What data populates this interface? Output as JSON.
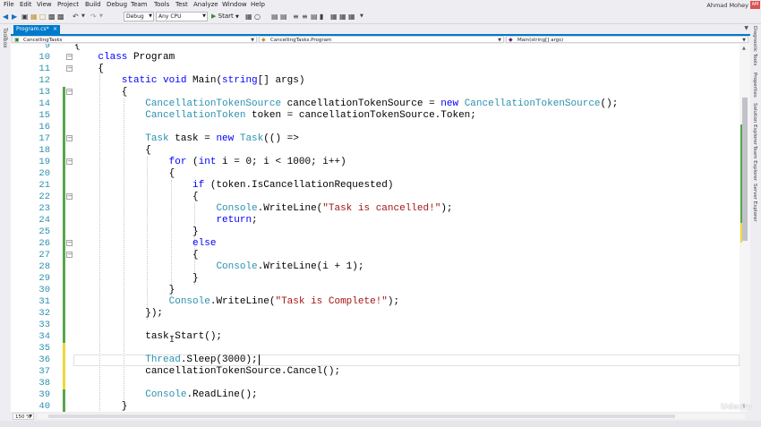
{
  "menu": [
    "File",
    "Edit",
    "View",
    "Project",
    "Build",
    "Debug",
    "Team",
    "Tools",
    "Test",
    "Analyze",
    "Window",
    "Help"
  ],
  "user": {
    "name": "Ahmad Mohey",
    "initials": "AM"
  },
  "toolbar": {
    "config": "Debug",
    "platform": "Any CPU",
    "start": "Start"
  },
  "tabs": {
    "active": "Program.cs*"
  },
  "side": {
    "left": "Toolbox",
    "right": [
      "Diagnostic Tools",
      "Properties",
      "Solution Explorer",
      "Team Explorer",
      "Server Explorer"
    ]
  },
  "nav": {
    "project": "CancellingTasks",
    "type": "CancellingTasks.Program",
    "member": "Main(string[] args)"
  },
  "editor": {
    "zoom": "150 %",
    "lines": [
      {
        "n": "9",
        "t": "{"
      },
      {
        "n": "10",
        "t": "    class Program"
      },
      {
        "n": "11",
        "t": "    {"
      },
      {
        "n": "12",
        "t": "        static void Main(string[] args)"
      },
      {
        "n": "13",
        "t": "        {"
      },
      {
        "n": "14",
        "t": "            CancellationTokenSource cancellationTokenSource = new CancellationTokenSource();"
      },
      {
        "n": "15",
        "t": "            CancellationToken token = cancellationTokenSource.Token;"
      },
      {
        "n": "16",
        "t": ""
      },
      {
        "n": "17",
        "t": "            Task task = new Task(() =>"
      },
      {
        "n": "18",
        "t": "            {"
      },
      {
        "n": "19",
        "t": "                for (int i = 0; i < 1000; i++)"
      },
      {
        "n": "20",
        "t": "                {"
      },
      {
        "n": "21",
        "t": "                    if (token.IsCancellationRequested)"
      },
      {
        "n": "22",
        "t": "                    {"
      },
      {
        "n": "23",
        "t": "                        Console.WriteLine(\"Task is cancelled!\");"
      },
      {
        "n": "24",
        "t": "                        return;"
      },
      {
        "n": "25",
        "t": "                    }"
      },
      {
        "n": "26",
        "t": "                    else"
      },
      {
        "n": "27",
        "t": "                    {"
      },
      {
        "n": "28",
        "t": "                        Console.WriteLine(i + 1);"
      },
      {
        "n": "29",
        "t": "                    }"
      },
      {
        "n": "30",
        "t": "                }"
      },
      {
        "n": "31",
        "t": "                Console.WriteLine(\"Task is Complete!\");"
      },
      {
        "n": "32",
        "t": "            });"
      },
      {
        "n": "33",
        "t": ""
      },
      {
        "n": "34",
        "t": "            task.Start();"
      },
      {
        "n": "35",
        "t": ""
      },
      {
        "n": "36",
        "t": "            Thread.Sleep(3000);"
      },
      {
        "n": "37",
        "t": "            cancellationTokenSource.Cancel();"
      },
      {
        "n": "38",
        "t": ""
      },
      {
        "n": "39",
        "t": "            Console.ReadLine();"
      },
      {
        "n": "40",
        "t": "        }"
      }
    ]
  },
  "colors": {
    "accent": "#007acc",
    "keyword": "#0000ff",
    "type": "#2b91af",
    "string": "#a31515",
    "saved_change": "#57a64a",
    "unsaved_change": "#efd83a"
  },
  "watermark": "Udemy"
}
